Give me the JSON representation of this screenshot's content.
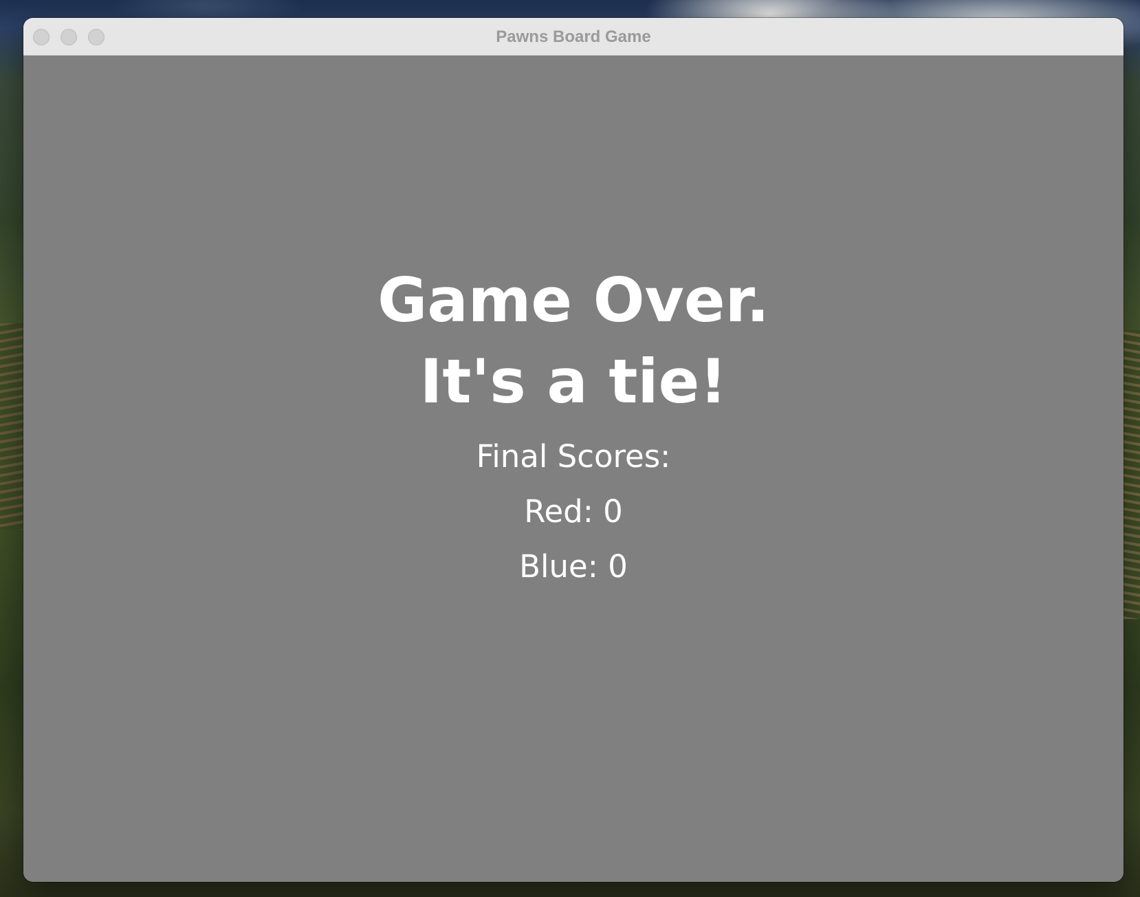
{
  "window": {
    "title": "Pawns Board Game"
  },
  "game_over": {
    "line1": "Game Over.",
    "line2": "It's a tie!",
    "final_scores_label": "Final Scores:",
    "red_label": "Red: 0",
    "blue_label": "Blue: 0"
  },
  "scores": {
    "red": 0,
    "blue": 0
  },
  "colors": {
    "content_background": "#808080",
    "text": "#ffffff",
    "titlebar": "#e6e6e6",
    "title_text": "#9a9a9a"
  }
}
